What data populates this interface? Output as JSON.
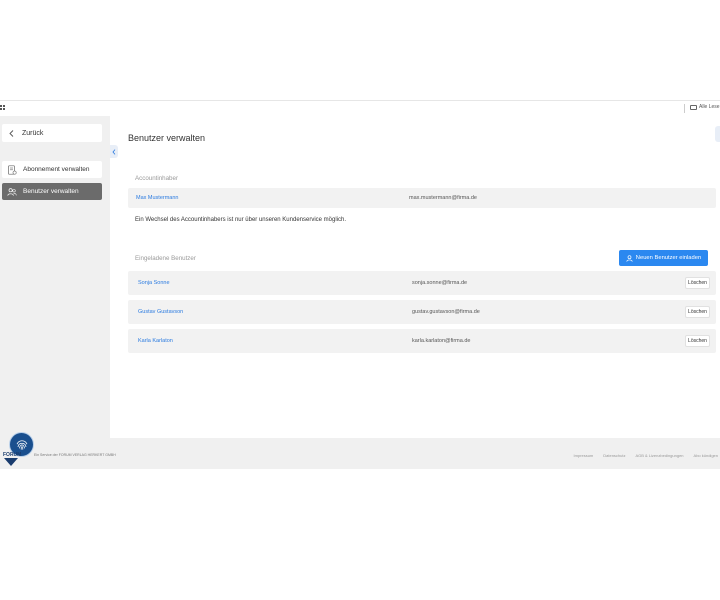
{
  "browser": {
    "bookmark_folder_label": "Alle Lese"
  },
  "sidebar": {
    "back_label": "Zurück",
    "items": [
      {
        "label": "Abonnement verwalten",
        "icon": "document-icon",
        "active": false
      },
      {
        "label": "Benutzer verwalten",
        "icon": "users-icon",
        "active": true
      }
    ]
  },
  "main": {
    "title": "Benutzer verwalten",
    "account_owner_section": "Accountinhaber",
    "owner": {
      "name": "Max Mustermann",
      "email": "max.mustermann@firma.de"
    },
    "owner_note": "Ein Wechsel des Accountinhabers ist nur über unseren Kundenservice möglich.",
    "invited_section": "Eingeladene Benutzer",
    "invite_button": "Neuen Benutzer einladen",
    "delete_label": "Löschen",
    "invited_users": [
      {
        "name": "Sonja Sonne",
        "email": "sonja.sonne@firma.de"
      },
      {
        "name": "Gustav Gustavson",
        "email": "gustav.gustavson@firma.de"
      },
      {
        "name": "Karla Karlaton",
        "email": "karla.karlaton@firma.de"
      }
    ]
  },
  "footer": {
    "text": "Ein Service der FORUM VERLAG HERKERT GMBH",
    "links": [
      "Impressum",
      "Datenschutz",
      "AGB & Lizenzbedingungen",
      "Abo kündigen"
    ]
  },
  "logo": {
    "label": "FORUM"
  },
  "colors": {
    "accent": "#2b88f0",
    "link": "#2b7be0",
    "active_nav": "#6b6b6b"
  }
}
